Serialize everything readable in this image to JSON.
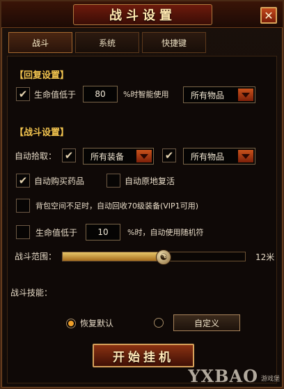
{
  "window": {
    "title": "战斗设置",
    "close_symbol": "✕"
  },
  "tabs": [
    {
      "label": "战斗",
      "active": true
    },
    {
      "label": "系统",
      "active": false
    },
    {
      "label": "快捷键",
      "active": false
    }
  ],
  "recovery": {
    "section_title": "【回复设置】",
    "hp_label": "生命值低于",
    "hp_checked": true,
    "hp_value": "80",
    "hp_suffix": "%时智能使用",
    "item_select": "所有物品"
  },
  "combat": {
    "section_title": "【战斗设置】",
    "autopick_label": "自动拾取：",
    "pick_equip_checked": true,
    "pick_equip_select": "所有装备",
    "pick_items_checked": true,
    "pick_items_select": "所有物品",
    "auto_buy_label": "自动购买药品",
    "auto_buy_checked": true,
    "auto_revive_label": "自动原地复活",
    "auto_revive_checked": false,
    "recycle_label": "背包空间不足时，自动回收70级装备(VIP1可用)",
    "recycle_checked": false,
    "lowhp_label": "生命值低于",
    "lowhp_checked": false,
    "lowhp_value": "10",
    "lowhp_suffix": "%时，自动使用随机符",
    "range_label": "战斗范围：",
    "range_value": "12米",
    "range_fraction": 0.55,
    "skills_label": "战斗技能：",
    "restore_default_label": "恢复默认",
    "restore_default_selected": true,
    "custom_label": "自定义",
    "custom_selected": false
  },
  "start_button": "开始挂机",
  "watermark": {
    "brand": "YXBAO",
    "sub": "游戏堡"
  },
  "colors": {
    "accent": "#f2c44f",
    "button": "#8a3212",
    "arrow": "#c8521c"
  }
}
